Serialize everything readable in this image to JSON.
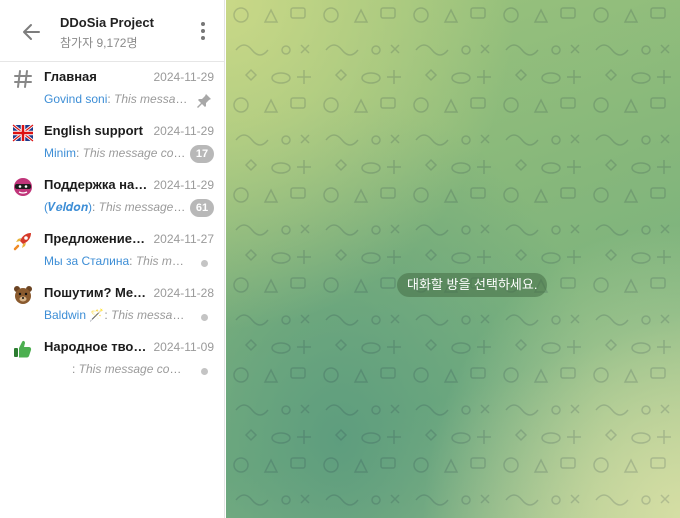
{
  "header": {
    "title": "DDoSia Project",
    "subtitle": "참가자 9,172명"
  },
  "topics": [
    {
      "name": "Главная",
      "date": "2024-11-29",
      "sender": "Govind soni",
      "message": "This message couldn't be displayed",
      "indicator": "pin"
    },
    {
      "name": "English support",
      "date": "2024-11-29",
      "sender": "Minim",
      "message": "This message couldn't be displayed",
      "badge": "17",
      "indicator": "badge"
    },
    {
      "name": "Поддержка на русском",
      "date": "2024-11-29",
      "sender": "(𝑽𝒆𝒍𝒅𝒐𝒏)",
      "message": "This message couldn't be displayed",
      "badge": "61",
      "indicator": "badge"
    },
    {
      "name": "Предложение целей",
      "date": "2024-11-27",
      "sender": "Мы за Сталина",
      "message": "This message couldn't be displayed",
      "indicator": "dot"
    },
    {
      "name": "Пошутим? Мемы",
      "date": "2024-11-28",
      "sender": "Baldwin 🪄",
      "message": "This message couldn't be displayed",
      "indicator": "dot"
    },
    {
      "name": "Народное творчество",
      "date": "2024-11-09",
      "sender": "",
      "message": "This message couldn't be displayed",
      "indicator": "dot"
    }
  ],
  "chat": {
    "empty_text": "대화할 방을 선택하세요."
  },
  "colors": {
    "sender": "#3d8ed6",
    "badge": "#b8b8b8"
  }
}
